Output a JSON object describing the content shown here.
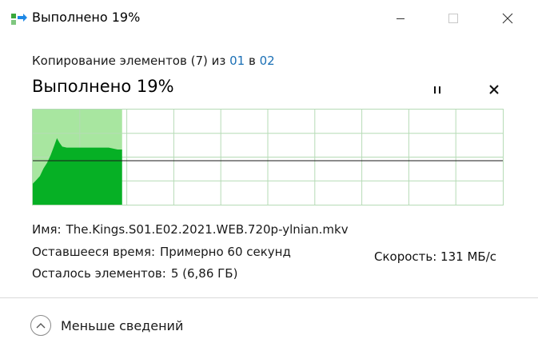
{
  "window": {
    "title": "Выполнено 19%",
    "icon": "copy-files-icon"
  },
  "operation": {
    "prefix": "Копирование элементов (7) из",
    "source": "01",
    "middle": "в",
    "destination": "02"
  },
  "progress": {
    "title": "Выполнено 19%",
    "percent": 19,
    "speed_label": "Скорость: 131 МБ/с"
  },
  "details": {
    "name_label": "Имя:",
    "name_value": "The.Kings.S01.E02.2021.WEB.720p-ylnian.mkv",
    "time_label": "Оставшееся время:",
    "time_value": "Примерно 60 секунд",
    "items_label": "Осталось элементов:",
    "items_value": "5 (6,86 ГБ)"
  },
  "footer": {
    "less_details_label": "Меньше сведений"
  },
  "colors": {
    "progress_fill": "#a8e6a0",
    "speed_fill": "#06b025",
    "grid": "#b6dbb6",
    "link": "#1a6fb5"
  }
}
